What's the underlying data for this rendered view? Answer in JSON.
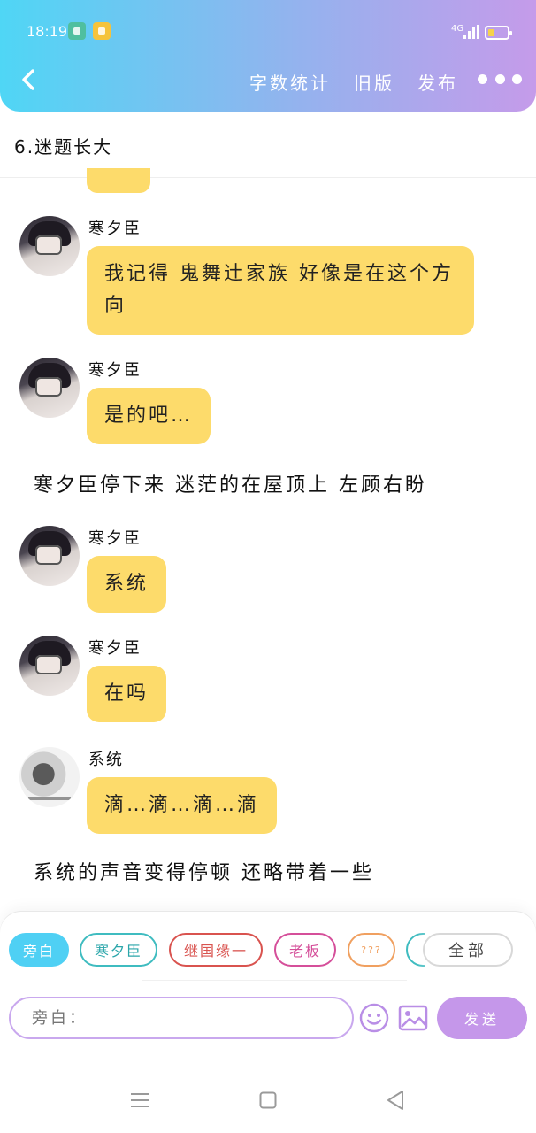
{
  "status_bar": {
    "time": "18:19",
    "network": "4G"
  },
  "header": {
    "nav_links": [
      "字数统计",
      "旧版",
      "发布"
    ]
  },
  "chapter_title": "6.迷题长大",
  "messages": [
    {
      "sender": "寒夕臣",
      "text": "我记得 鬼舞辻家族 好像是在这个方向"
    },
    {
      "sender": "寒夕臣",
      "text": "是的吧…"
    },
    {
      "narration": "寒夕臣停下来 迷茫的在屋顶上 左顾右盼"
    },
    {
      "sender": "寒夕臣",
      "text": "系统"
    },
    {
      "sender": "寒夕臣",
      "text": "在吗"
    },
    {
      "sender": "系统",
      "text": "滴…滴…滴…滴"
    },
    {
      "narration": "系统的声音变得停顿 还略带着一些"
    }
  ],
  "role_chips": [
    {
      "label": "旁白",
      "color": "#4fd0f4",
      "active": true
    },
    {
      "label": "寒夕臣",
      "color": "#3fbcc0"
    },
    {
      "label": "继国缘一",
      "color": "#d9534f"
    },
    {
      "label": "老板",
      "color": "#d54f9a"
    },
    {
      "label": "???",
      "color": "#f0a060"
    },
    {
      "label": "",
      "color": "#3fbcc0"
    }
  ],
  "all_chip_label": "全部",
  "input": {
    "placeholder": "旁白："
  },
  "send_label": "发送",
  "colors": {
    "bubble": "#fddb6b",
    "header_start": "#4fd6f5",
    "header_end": "#c59bea",
    "send": "#c597ea"
  },
  "icons": [
    "back-arrow-icon",
    "more-dots-icon",
    "emoji-icon",
    "image-icon",
    "menu-icon",
    "home-icon",
    "back-triangle-icon"
  ]
}
